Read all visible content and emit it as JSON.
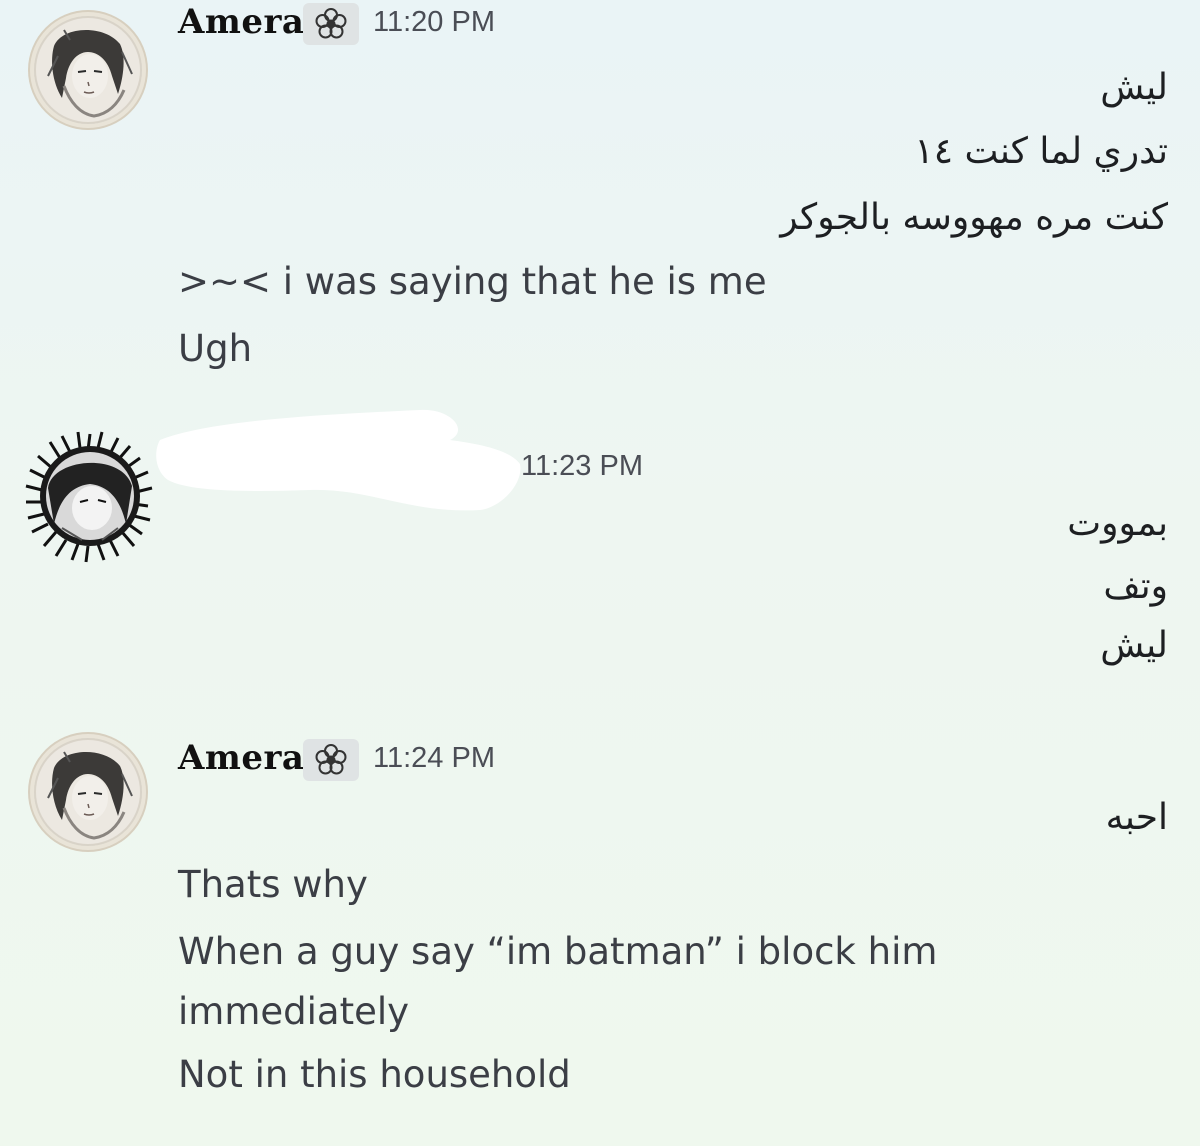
{
  "messages": [
    {
      "author": "Amera",
      "time": "11:20 PM",
      "lines": [
        "ليش",
        "تدري لما كنت ١٤",
        "كنت مره مهووسه بالجوكر",
        ">~< i was saying that he is me",
        "Ugh"
      ]
    },
    {
      "author": "",
      "time": "11:23 PM",
      "lines": [
        "بمووت",
        "وتف",
        "ليش"
      ]
    },
    {
      "author": "Amera",
      "time": "11:24 PM",
      "lines": [
        "احبه",
        "Thats why",
        "When a guy say “im batman” i block him immediately",
        "Not in this household"
      ]
    }
  ],
  "icons": {
    "author_badge": "flower-icon",
    "redaction_color": "#ffffff"
  }
}
